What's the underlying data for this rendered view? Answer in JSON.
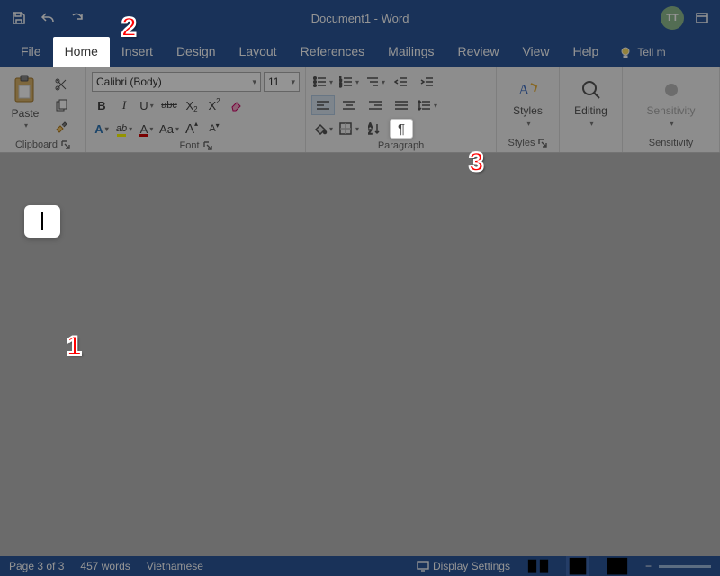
{
  "title": "Document1 - Word",
  "user_initials": "TT",
  "qat": {
    "save": "save-icon",
    "undo": "undo-icon",
    "redo": "redo-icon"
  },
  "tabs": [
    "File",
    "Home",
    "Insert",
    "Design",
    "Layout",
    "References",
    "Mailings",
    "Review",
    "View",
    "Help"
  ],
  "active_tab_index": 1,
  "tellme": "Tell m",
  "ribbon": {
    "clipboard": {
      "label": "Clipboard",
      "paste": "Paste"
    },
    "font": {
      "label": "Font",
      "name": "Calibri (Body)",
      "size": "11",
      "bold": "B",
      "italic": "I",
      "underline": "U",
      "strike": "abc",
      "subscript_base": "X",
      "superscript_base": "X",
      "texteffects": "A",
      "highlight": "ab",
      "fontcolor": "A",
      "case": "Aa",
      "grow": "A",
      "shrink": "A"
    },
    "paragraph": {
      "label": "Paragraph"
    },
    "styles": {
      "label": "Styles",
      "button": "Styles"
    },
    "editing": {
      "label": "",
      "button": "Editing"
    },
    "sensitivity": {
      "label": "Sensitivity",
      "button": "Sensitivity"
    }
  },
  "callouts": {
    "one": "1",
    "two": "2",
    "three": "3"
  },
  "statusbar": {
    "page": "Page 3 of 3",
    "words": "457 words",
    "lang": "Vietnamese",
    "display_settings": "Display Settings"
  }
}
